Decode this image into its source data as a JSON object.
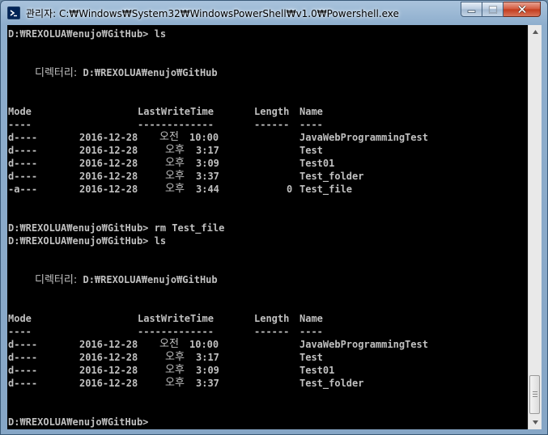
{
  "window": {
    "title": "관리자: C:₩Windows₩System32₩WindowsPowerShell₩v1.0₩Powershell.exe"
  },
  "session": {
    "prompt": "D:₩REXOLUA₩enujo₩GitHub>",
    "cmd1": "ls",
    "cmd2": "rm Test_file",
    "cmd3": "ls"
  },
  "listing1": {
    "dir_label": "디렉터리:",
    "dir_path": "D:₩REXOLUA₩enujo₩GitHub",
    "headers": {
      "mode": "Mode",
      "time": "LastWriteTime",
      "length": "Length",
      "name": "Name"
    },
    "underlines": {
      "mode": "----",
      "time": "-------------",
      "length": "------",
      "name": "----"
    },
    "rows": [
      {
        "mode": "d----",
        "date": "2016-12-28",
        "ampm": "오전",
        "time": "10:00",
        "length": "",
        "name": "JavaWebProgrammingTest"
      },
      {
        "mode": "d----",
        "date": "2016-12-28",
        "ampm": "오후",
        "time": "3:17",
        "length": "",
        "name": "Test"
      },
      {
        "mode": "d----",
        "date": "2016-12-28",
        "ampm": "오후",
        "time": "3:09",
        "length": "",
        "name": "Test01"
      },
      {
        "mode": "d----",
        "date": "2016-12-28",
        "ampm": "오후",
        "time": "3:37",
        "length": "",
        "name": "Test_folder"
      },
      {
        "mode": "-a---",
        "date": "2016-12-28",
        "ampm": "오후",
        "time": "3:44",
        "length": "0",
        "name": "Test_file"
      }
    ]
  },
  "listing2": {
    "dir_label": "디렉터리:",
    "dir_path": "D:₩REXOLUA₩enujo₩GitHub",
    "headers": {
      "mode": "Mode",
      "time": "LastWriteTime",
      "length": "Length",
      "name": "Name"
    },
    "underlines": {
      "mode": "----",
      "time": "-------------",
      "length": "------",
      "name": "----"
    },
    "rows": [
      {
        "mode": "d----",
        "date": "2016-12-28",
        "ampm": "오전",
        "time": "10:00",
        "length": "",
        "name": "JavaWebProgrammingTest"
      },
      {
        "mode": "d----",
        "date": "2016-12-28",
        "ampm": "오후",
        "time": "3:17",
        "length": "",
        "name": "Test"
      },
      {
        "mode": "d----",
        "date": "2016-12-28",
        "ampm": "오후",
        "time": "3:09",
        "length": "",
        "name": "Test01"
      },
      {
        "mode": "d----",
        "date": "2016-12-28",
        "ampm": "오후",
        "time": "3:37",
        "length": "",
        "name": "Test_folder"
      }
    ]
  },
  "colors": {
    "console_bg": "#000000",
    "console_fg": "#c0c0c0",
    "titlebar": "#8eaecd",
    "close": "#c23a1c"
  },
  "icons": {
    "app": "powershell-icon",
    "minimize": "minimize-icon",
    "maximize": "maximize-icon",
    "close": "close-icon"
  }
}
